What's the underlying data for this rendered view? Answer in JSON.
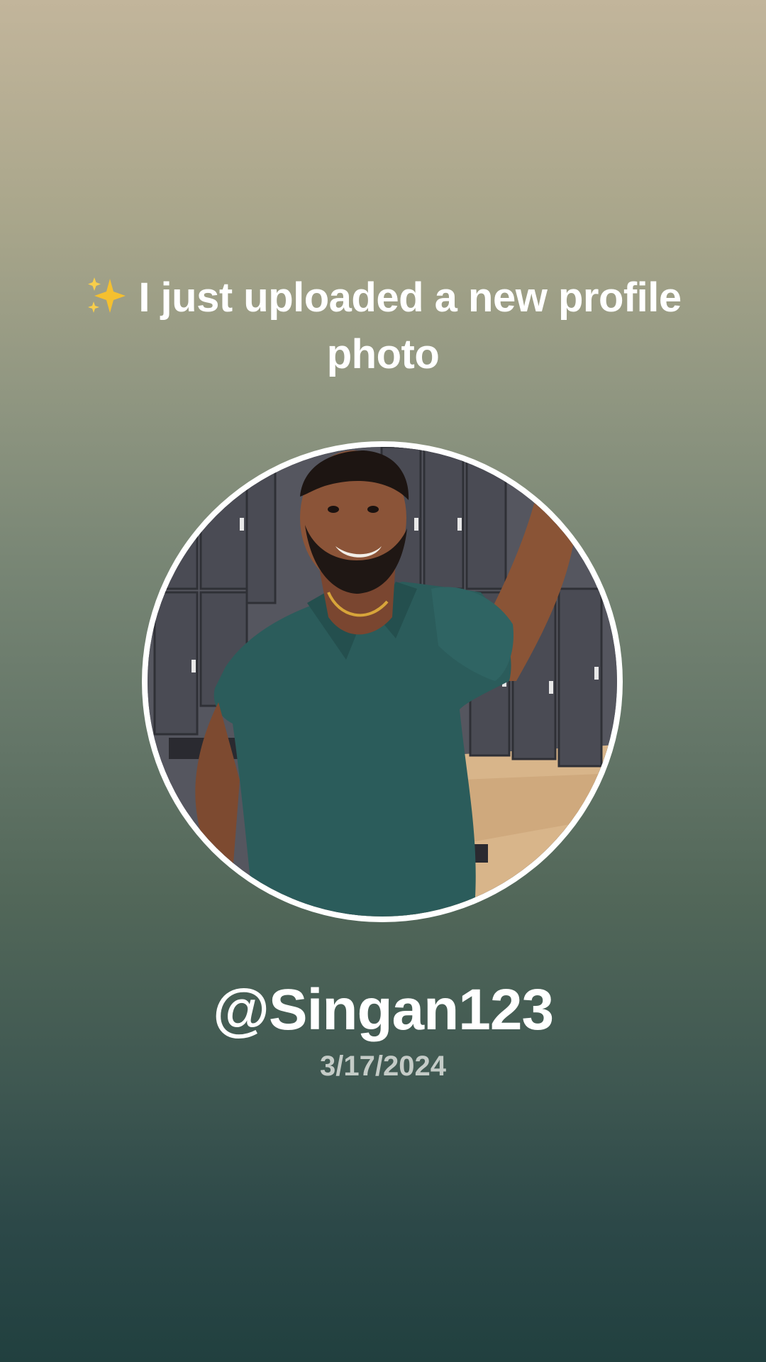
{
  "post": {
    "icon": "sparkles-icon",
    "headline": "I just uploaded a new profile photo",
    "username": "@Singan123",
    "date": "3/17/2024"
  },
  "colors": {
    "gradient_top": "#c2b59b",
    "gradient_bottom": "#21403f",
    "text": "#ffffff",
    "date_text": "#c4cbc7",
    "avatar_ring": "#ffffff",
    "sparkle": "#f5c02f"
  }
}
